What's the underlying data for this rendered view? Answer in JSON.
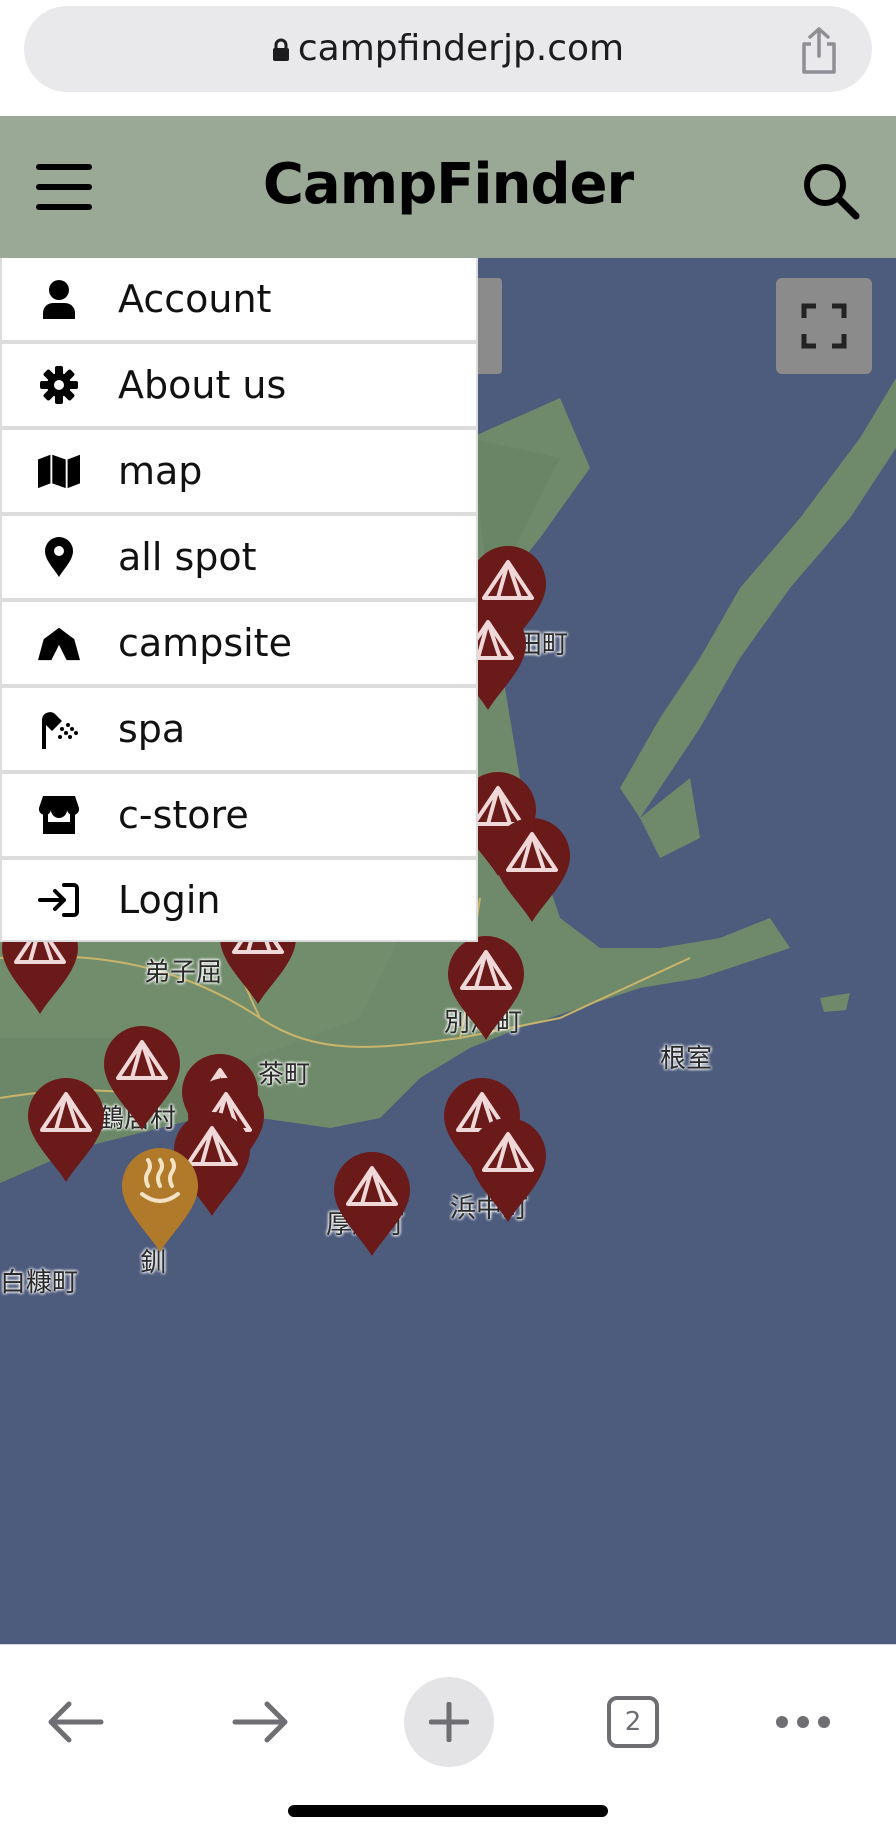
{
  "browser": {
    "url": "campfinderjp.com",
    "tabs_count": "2"
  },
  "header": {
    "brand": "CampFinder"
  },
  "menu": {
    "items": [
      {
        "label": "Account",
        "icon": "user-icon"
      },
      {
        "label": "About us",
        "icon": "gear-icon"
      },
      {
        "label": "map",
        "icon": "map-icon"
      },
      {
        "label": "all spot",
        "icon": "location-pin-icon"
      },
      {
        "label": "campsite",
        "icon": "tent-icon"
      },
      {
        "label": "spa",
        "icon": "shower-icon"
      },
      {
        "label": "c-store",
        "icon": "store-icon"
      },
      {
        "label": "Login",
        "icon": "login-icon"
      }
    ]
  },
  "map": {
    "labels": {
      "l1": "田町",
      "l2": "弟子屈",
      "l3": "茶町",
      "l4": "別海町",
      "l5": "根室",
      "l6": "鶴居村",
      "l7": "厚岸町",
      "l8": "浜中町",
      "l9": "白糠町",
      "l10": "釧"
    }
  },
  "colors": {
    "header_bg": "#9aa896",
    "sea": "#4d5b7c",
    "land": "#6f8a6a",
    "campsite_pin": "#6b1a1a",
    "spa_pin": "#b07a2a"
  }
}
